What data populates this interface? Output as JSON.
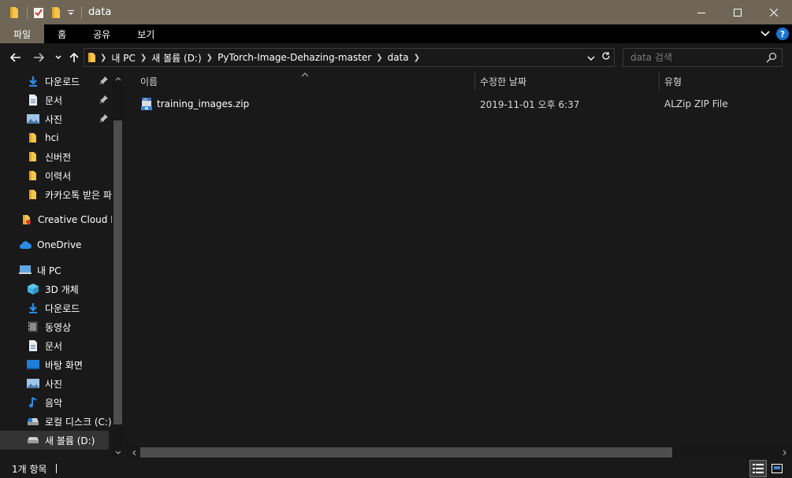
{
  "window": {
    "title": "data"
  },
  "ribbon": {
    "tabs": [
      {
        "label": "파일",
        "active": true
      },
      {
        "label": "홈",
        "active": false
      },
      {
        "label": "공유",
        "active": false
      },
      {
        "label": "보기",
        "active": false
      }
    ]
  },
  "address": {
    "crumbs": [
      "내 PC",
      "새 볼륨 (D:)",
      "PyTorch-Image-Dehazing-master",
      "data"
    ]
  },
  "search": {
    "placeholder": "data 검색"
  },
  "navpane": {
    "items": [
      {
        "label": "다운로드",
        "icon": "download-arrow-icon",
        "pinned": true
      },
      {
        "label": "문서",
        "icon": "document-icon",
        "pinned": true
      },
      {
        "label": "사진",
        "icon": "pictures-icon",
        "pinned": true
      },
      {
        "label": "hci",
        "icon": "folder-icon",
        "pinned": false
      },
      {
        "label": "신버전",
        "icon": "folder-icon",
        "pinned": false
      },
      {
        "label": "이력서",
        "icon": "folder-icon",
        "pinned": false
      },
      {
        "label": "카카오톡 받은 파",
        "icon": "folder-icon",
        "pinned": false
      },
      {
        "label": "Creative Cloud Fil",
        "icon": "creative-cloud-icon",
        "pinned": false
      },
      {
        "label": "OneDrive",
        "icon": "onedrive-cloud-icon",
        "pinned": false
      },
      {
        "label": "내 PC",
        "icon": "computer-icon",
        "pinned": false
      },
      {
        "label": "3D 개체",
        "icon": "3d-objects-icon",
        "pinned": false
      },
      {
        "label": "다운로드",
        "icon": "download-arrow-icon",
        "pinned": false
      },
      {
        "label": "동영상",
        "icon": "video-icon",
        "pinned": false
      },
      {
        "label": "문서",
        "icon": "document-icon",
        "pinned": false
      },
      {
        "label": "바탕 화면",
        "icon": "desktop-icon",
        "pinned": false
      },
      {
        "label": "사진",
        "icon": "pictures-icon",
        "pinned": false
      },
      {
        "label": "음악",
        "icon": "music-note-icon",
        "pinned": false
      },
      {
        "label": "로컬 디스크 (C:)",
        "icon": "local-disk-icon",
        "pinned": false
      },
      {
        "label": "새 볼륨 (D:)",
        "icon": "drive-icon",
        "pinned": false,
        "selected": true
      }
    ]
  },
  "columns": {
    "name": "이름",
    "modified": "수정한 날짜",
    "type": "유형"
  },
  "files": [
    {
      "name": "training_images.zip",
      "modified": "2019-11-01 오후 6:37",
      "type": "ALZip ZIP File",
      "icon": "zip-file-icon"
    }
  ],
  "status": {
    "count": "1개 항목"
  },
  "colors": {
    "titlebar": "#6f6657",
    "background": "#191919",
    "folder": "#f5c54a",
    "accent_blue": "#1a74d2"
  }
}
